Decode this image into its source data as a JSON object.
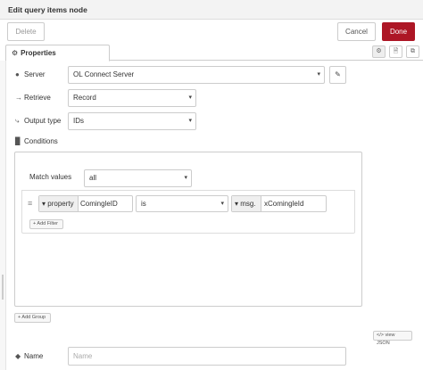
{
  "dialog": {
    "title": "Edit query items node"
  },
  "toolbar": {
    "delete_label": "Delete",
    "cancel_label": "Cancel",
    "done_label": "Done"
  },
  "tabs": {
    "properties_label": "Properties"
  },
  "fields": {
    "server": {
      "label": "Server",
      "value": "OL Connect Server"
    },
    "retrieve": {
      "label": "Retrieve",
      "value": "Record"
    },
    "output_type": {
      "label": "Output type",
      "value": "IDs"
    },
    "conditions": {
      "label": "Conditions"
    },
    "name": {
      "label": "Name",
      "placeholder": "Name",
      "value": ""
    }
  },
  "conditions": {
    "match_label": "Match values",
    "match_value": "all",
    "rule": {
      "property_type": "property",
      "property_value": "ComingleID",
      "operator": "is",
      "msg_type": "msg.",
      "msg_value": "xComingleId"
    },
    "add_filter_label": "+ Add Filter",
    "add_group_label": "+ Add Group",
    "view_json_label": "</> view JSON"
  },
  "icons": {
    "gear": "⚙",
    "pencil": "✎",
    "caret": "▾",
    "arrow_right": "→",
    "output": "⤷",
    "conditions": "▉",
    "tag": "◆",
    "drag": "≡",
    "document": "🗎",
    "frame": "⧉",
    "server": "●"
  },
  "colors": {
    "done_bg": "#ad1625",
    "border": "#cccccc"
  }
}
